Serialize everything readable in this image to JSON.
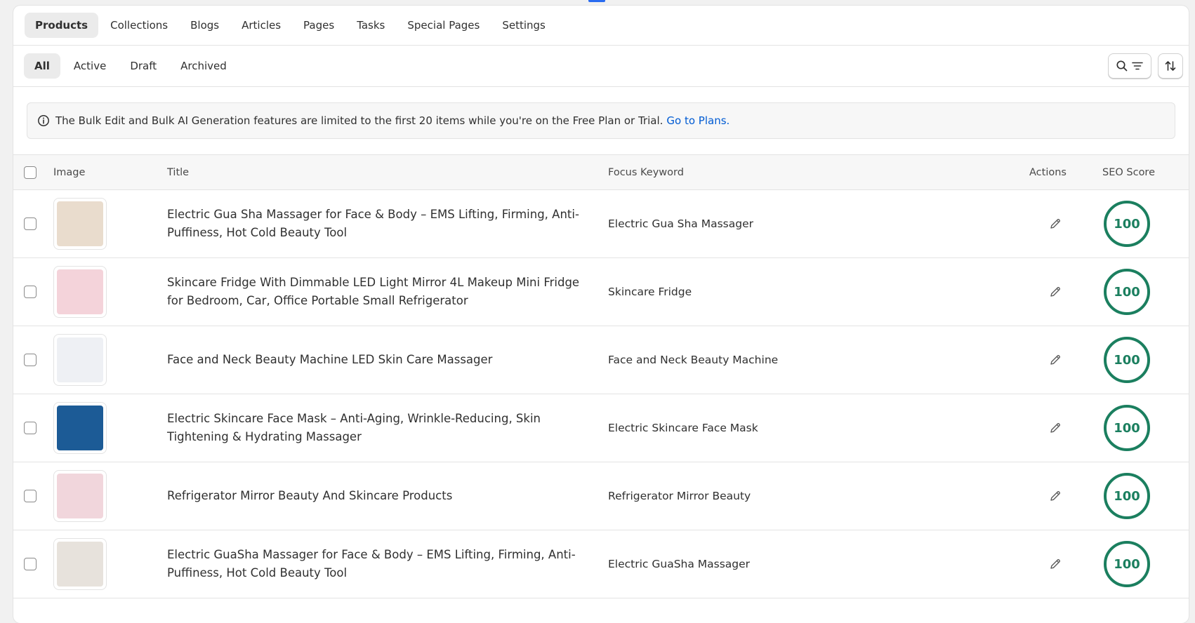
{
  "top_tabs": [
    "Products",
    "Collections",
    "Blogs",
    "Articles",
    "Pages",
    "Tasks",
    "Special Pages",
    "Settings"
  ],
  "sub_tabs": [
    "All",
    "Active",
    "Draft",
    "Archived"
  ],
  "banner": {
    "text": "The Bulk Edit and Bulk AI Generation features are limited to the first 20 items while you're on the Free Plan or Trial.",
    "link": "Go to Plans."
  },
  "table": {
    "headers": {
      "image": "Image",
      "title": "Title",
      "keyword": "Focus Keyword",
      "actions": "Actions",
      "seo": "SEO Score"
    },
    "rows": [
      {
        "title": "Electric Gua Sha Massager for Face & Body – EMS Lifting, Firming, Anti-Puffiness, Hot Cold Beauty Tool",
        "keyword": "Electric Gua Sha Massager",
        "score": "100",
        "thumb_color": "#e9dccd"
      },
      {
        "title": "Skincare Fridge With Dimmable LED Light Mirror 4L Makeup Mini Fridge for Bedroom, Car, Office Portable Small Refrigerator",
        "keyword": "Skincare Fridge",
        "score": "100",
        "thumb_color": "#f4d3da"
      },
      {
        "title": "Face and Neck Beauty Machine LED Skin Care Massager",
        "keyword": "Face and Neck Beauty Machine",
        "score": "100",
        "thumb_color": "#eef0f4"
      },
      {
        "title": "Electric Skincare Face Mask – Anti-Aging, Wrinkle-Reducing, Skin Tightening & Hydrating Massager",
        "keyword": "Electric Skincare Face Mask",
        "score": "100",
        "thumb_color": "#1c5b96"
      },
      {
        "title": "Refrigerator Mirror Beauty And Skincare Products",
        "keyword": "Refrigerator Mirror Beauty",
        "score": "100",
        "thumb_color": "#f1d6dc"
      },
      {
        "title": "Electric GuaSha Massager for Face & Body – EMS Lifting, Firming, Anti-Puffiness, Hot Cold Beauty Tool",
        "keyword": "Electric GuaSha Massager",
        "score": "100",
        "thumb_color": "#e7e2dc"
      }
    ]
  },
  "colors": {
    "score_green": "#1b7f5f",
    "link_blue": "#005bd3"
  }
}
